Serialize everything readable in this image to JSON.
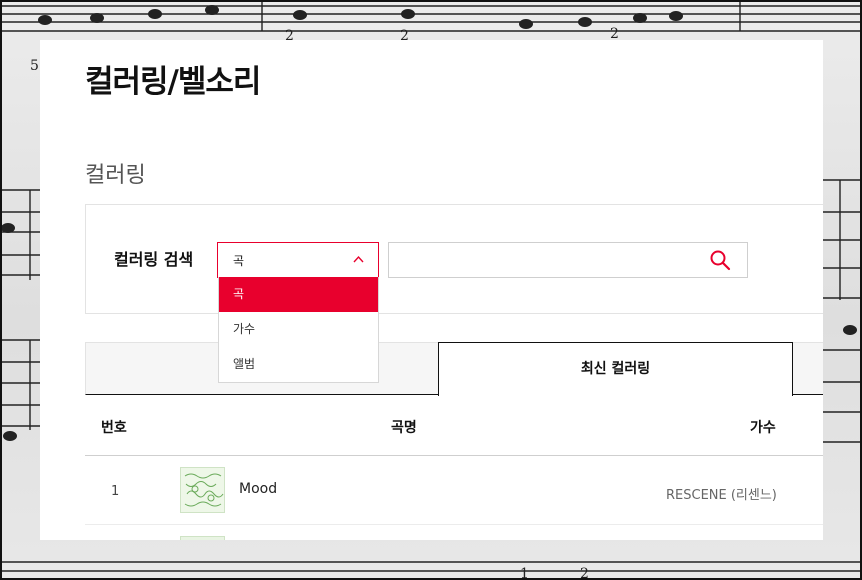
{
  "page": {
    "title": "컬러링/벨소리",
    "section_title": "컬러링"
  },
  "search": {
    "label": "컬러링 검색",
    "select_value": "곡",
    "options": [
      "곡",
      "가수",
      "앨범"
    ],
    "selected_option": "곡",
    "input_value": "",
    "input_placeholder": ""
  },
  "tabs": {
    "active_label": "최신 컬러링"
  },
  "table": {
    "headers": {
      "no": "번호",
      "song": "곡명",
      "artist": "가수"
    },
    "rows": [
      {
        "no": "1",
        "title": "Mood",
        "artist": "RESCENE (리센느)"
      },
      {
        "no": "",
        "title": "",
        "artist": ""
      }
    ]
  },
  "colors": {
    "accent": "#e8002d",
    "text": "#111111",
    "muted": "#666666"
  },
  "icons": {
    "select_caret": "chevron-up-icon",
    "search": "search-icon"
  }
}
